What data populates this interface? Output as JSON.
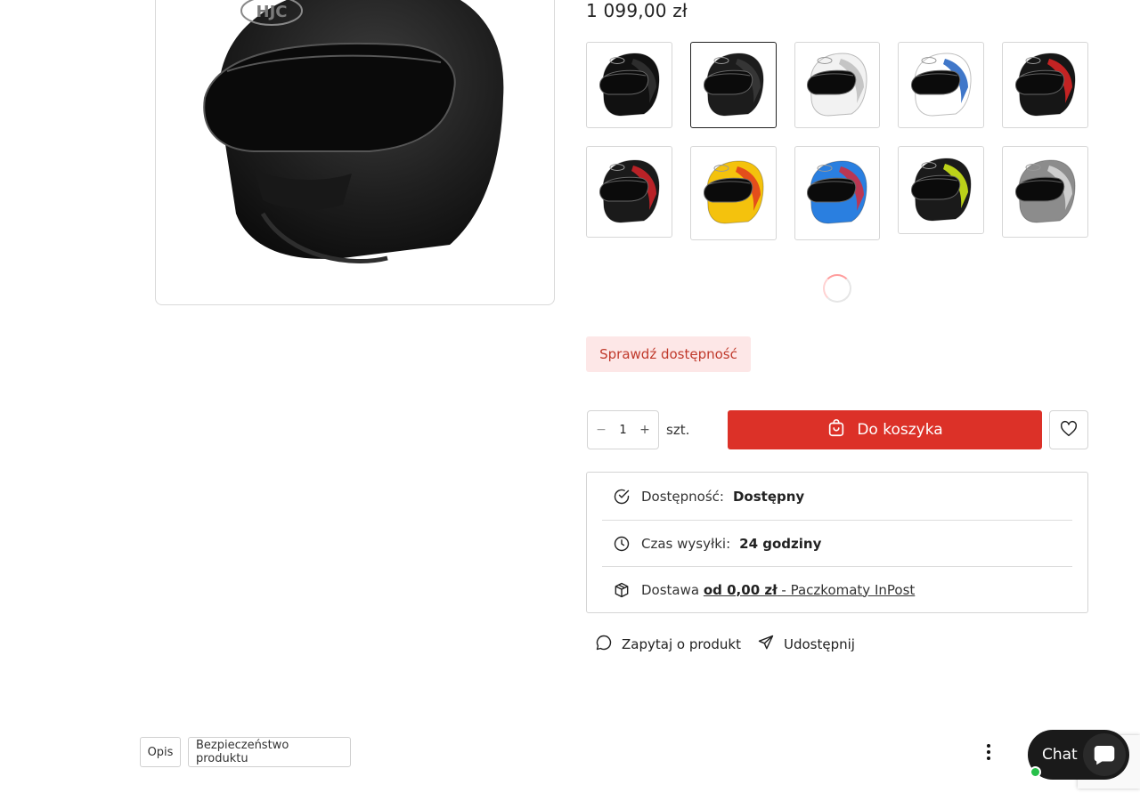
{
  "product": {
    "price": "1 099,00 zł",
    "main_image_icon": "helmet-main-image",
    "brand_logo": "HJC"
  },
  "variants": [
    {
      "icon": "helmet-variant-black-glossy",
      "colors": [
        "#111111",
        "#333333"
      ],
      "selected": false
    },
    {
      "icon": "helmet-variant-black-matte",
      "colors": [
        "#1c1c1c",
        "#3a3a3a"
      ],
      "selected": true
    },
    {
      "icon": "helmet-variant-white",
      "colors": [
        "#f2f2f2",
        "#bdbdbd"
      ],
      "selected": false
    },
    {
      "icon": "helmet-variant-white-blue-red",
      "colors": [
        "#ffffff",
        "#1f5fbf"
      ],
      "selected": false
    },
    {
      "icon": "helmet-variant-black-red",
      "colors": [
        "#161616",
        "#e32626"
      ],
      "selected": false
    },
    {
      "icon": "helmet-variant-black-red-graphic",
      "colors": [
        "#1a1a1a",
        "#d6252a"
      ],
      "selected": false
    },
    {
      "icon": "helmet-variant-yellow-red",
      "colors": [
        "#f4c20d",
        "#e03a1e"
      ],
      "selected": false
    },
    {
      "icon": "helmet-variant-blue-red-white",
      "colors": [
        "#2a7fe0",
        "#d42a3a"
      ],
      "selected": false
    },
    {
      "icon": "helmet-variant-black-fluo-yellow",
      "colors": [
        "#1a1a1a",
        "#d8f21a"
      ],
      "selected": false
    },
    {
      "icon": "helmet-variant-grey-silver",
      "colors": [
        "#8c8c8c",
        "#d9d9d9"
      ],
      "selected": false
    }
  ],
  "availability_check": {
    "label": "Sprawdź dostępność"
  },
  "purchase": {
    "qty_minus": "−",
    "qty_value": "1",
    "qty_plus": "+",
    "unit": "szt.",
    "cart_label": "Do koszyka",
    "cart_icon": "bag-icon",
    "wishlist_icon": "heart-icon"
  },
  "info": {
    "availability_label": "Dostępność:",
    "availability_value": "Dostępny",
    "shipping_label": "Czas wysyłki:",
    "shipping_value": "24 godziny",
    "delivery_label": "Dostawa",
    "delivery_price": "od 0,00 zł",
    "delivery_method": " - Paczkomaty InPost"
  },
  "actions": {
    "ask": "Zapytaj o produkt",
    "share": "Udostępnij"
  },
  "tabs": [
    {
      "label": "Opis"
    },
    {
      "label": "Bezpieczeństwo produktu"
    }
  ],
  "chat": {
    "label": "Chat"
  },
  "colors": {
    "accent": "#dc3128",
    "accent_light": "#fde7e7",
    "online": "#27c04a"
  }
}
